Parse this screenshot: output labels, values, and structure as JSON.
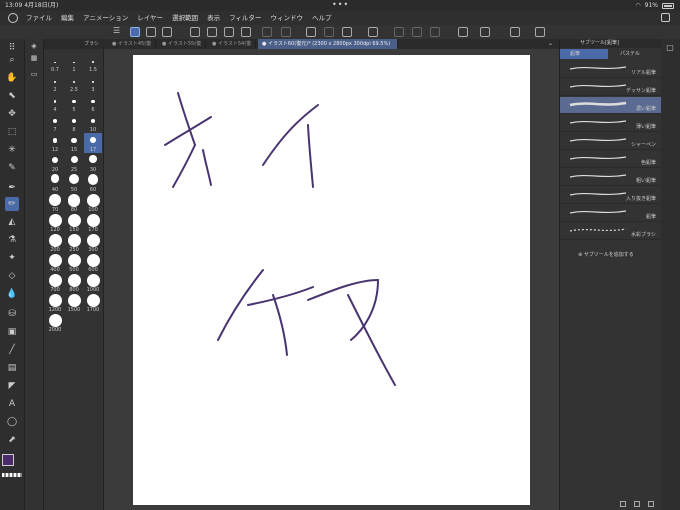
{
  "status": {
    "time": "13:09",
    "date": "4月18日(月)",
    "battery": "91%",
    "dots": "•••"
  },
  "menu": [
    "ファイル",
    "編集",
    "アニメーション",
    "レイヤー",
    "選択範囲",
    "表示",
    "フィルター",
    "ウィンドウ",
    "ヘルプ"
  ],
  "tabs": [
    {
      "label": "イラスト45(復"
    },
    {
      "label": "イラスト55(復"
    },
    {
      "label": "イラスト54(復"
    },
    {
      "label": "イラスト60(復元)* (2300 x 2800px 300dpi 69.5%)"
    }
  ],
  "brush_size": {
    "header": "ブラシ",
    "sizes": [
      "0.7",
      "1",
      "1.5",
      "2",
      "2.5",
      "3",
      "4",
      "5",
      "6",
      "7",
      "8",
      "10",
      "12",
      "15",
      "17",
      "20",
      "25",
      "30",
      "40",
      "50",
      "60",
      "70",
      "80",
      "100",
      "120",
      "150",
      "170",
      "200",
      "250",
      "300",
      "400",
      "500",
      "600",
      "700",
      "800",
      "1000",
      "1200",
      "1500",
      "1700",
      "2000"
    ]
  },
  "subtool": {
    "title": "サブツール[鉛筆]",
    "categories": [
      "鉛筆",
      "パステル"
    ],
    "brushes": [
      "リアル鉛筆",
      "デッサン鉛筆",
      "濃い鉛筆",
      "薄い鉛筆",
      "シャーペン",
      "色鉛筆",
      "粗い鉛筆",
      "入り抜き鉛筆",
      "鉛筆",
      "水彩ブラシ"
    ],
    "selected": "濃い鉛筆",
    "add_label": "サブツールを追加する"
  },
  "colors": {
    "main": "#4a2a6a",
    "sub": "#e08a30",
    "stroke": "#4a3470",
    "accent": "#4a6aa8"
  }
}
